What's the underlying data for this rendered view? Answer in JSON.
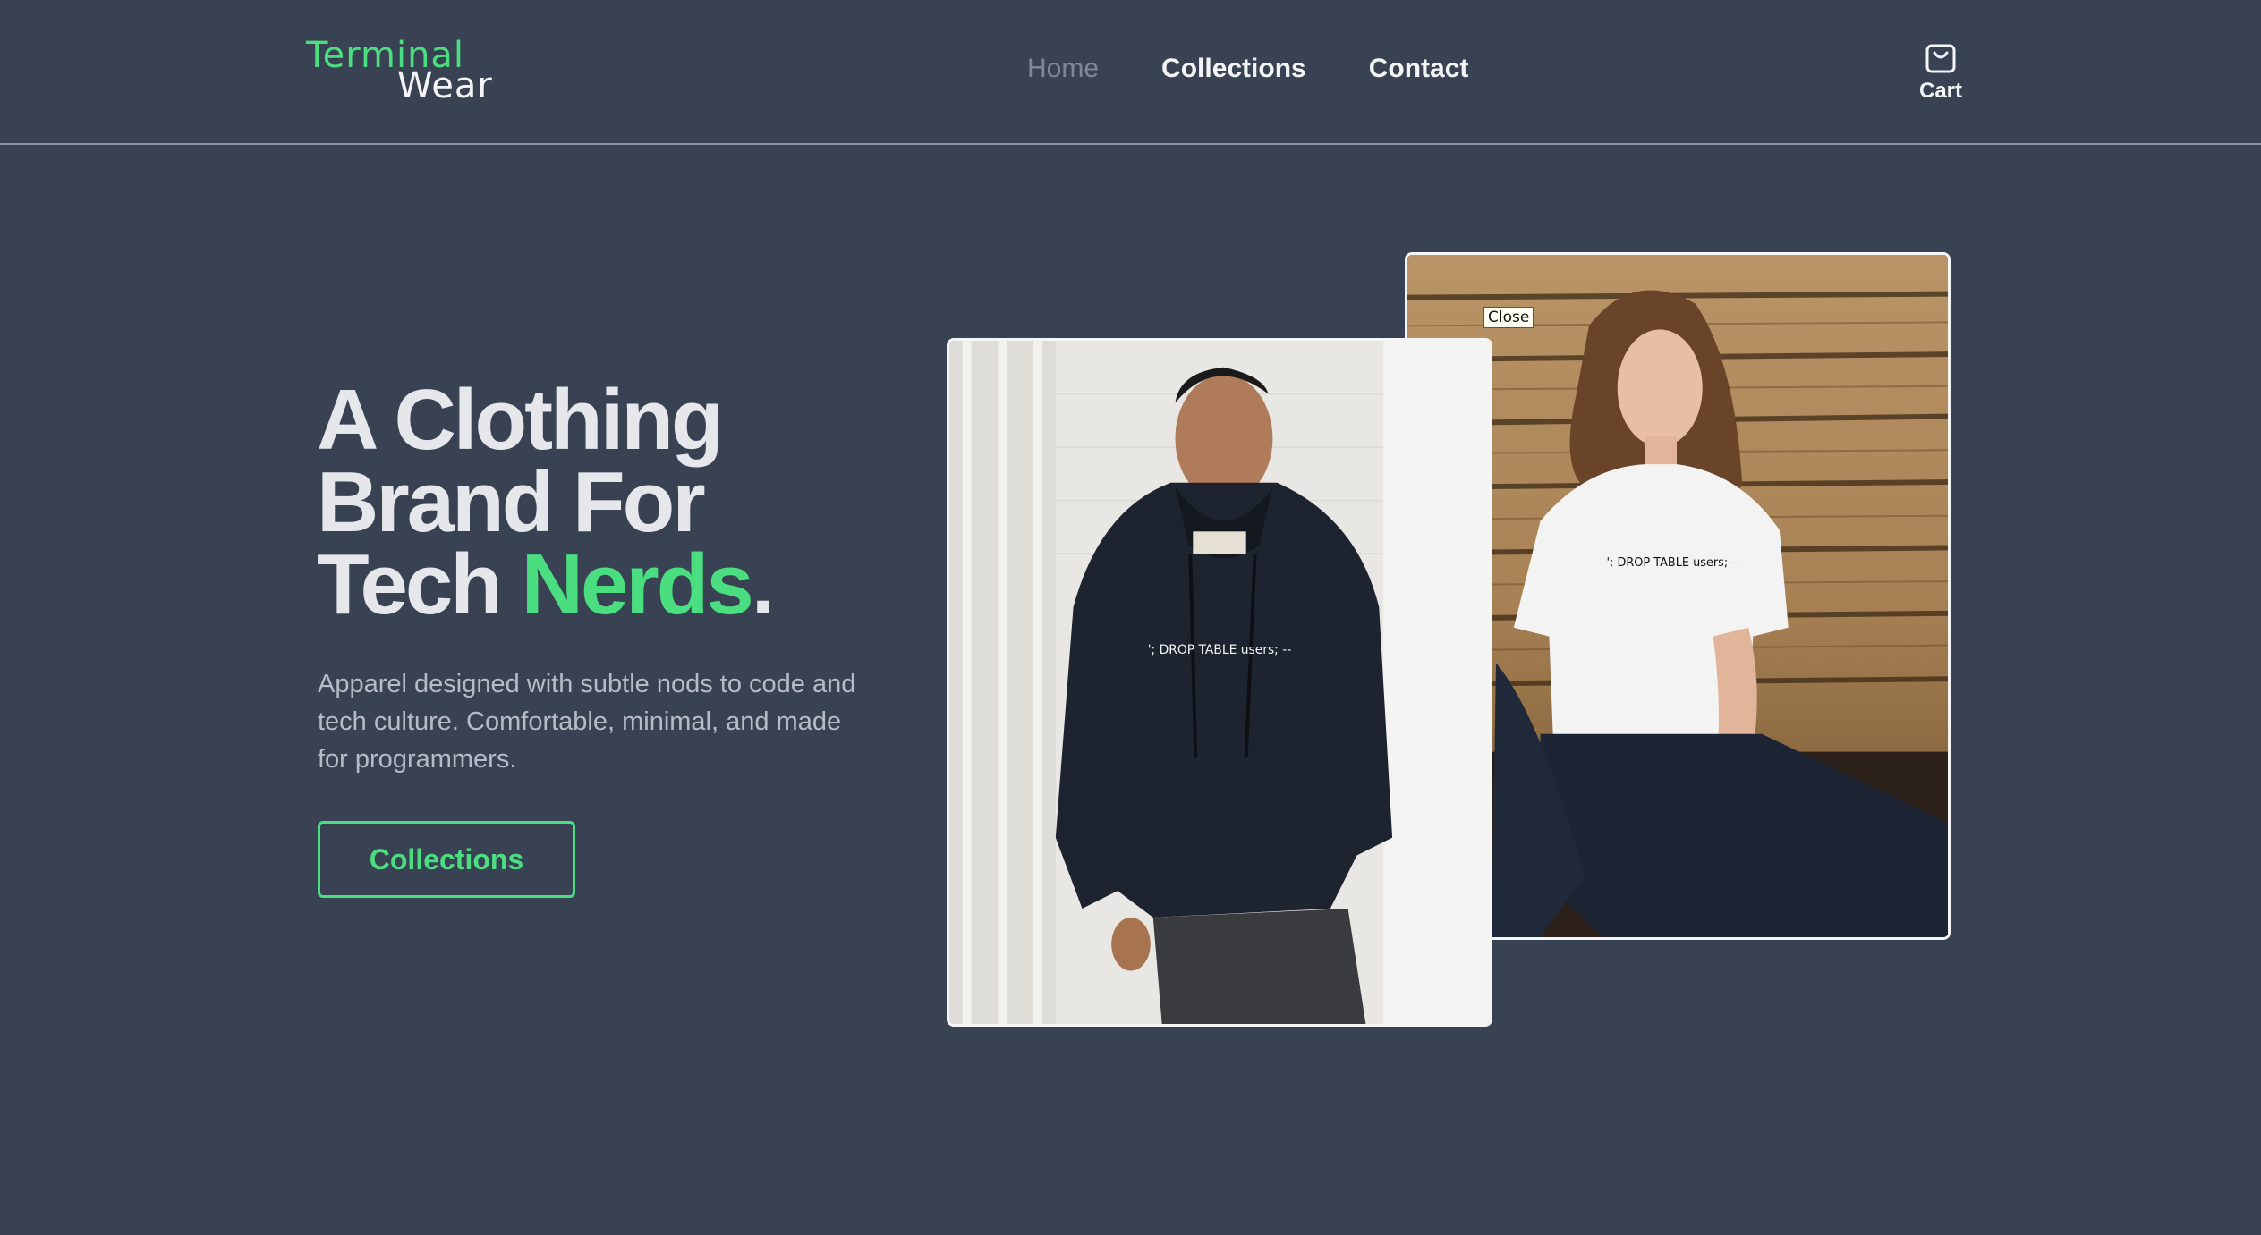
{
  "brand": {
    "line1": "Terminal",
    "line2": "Wear"
  },
  "nav": [
    {
      "label": "Home"
    },
    {
      "label": "Collections"
    },
    {
      "label": "Contact"
    }
  ],
  "cart": {
    "label": "Cart"
  },
  "hero": {
    "title_line1": "A Clothing",
    "title_line2": "Brand For",
    "title_line3_prefix": "Tech ",
    "title_line3_accent": "Nerds",
    "title_line3_suffix": ".",
    "description": "Apparel designed with subtle nods to code and tech culture. Comfortable, minimal, and made for programmers.",
    "cta_label": "Collections"
  },
  "photos": {
    "hoodie_print": "'; DROP TABLE users; --",
    "tshirt_print": "'; DROP TABLE users; --"
  },
  "close_label": "Close",
  "colors": {
    "background": "#394252",
    "accent": "#4ade80",
    "text": "#f3f4f6",
    "muted": "#7f8898"
  }
}
